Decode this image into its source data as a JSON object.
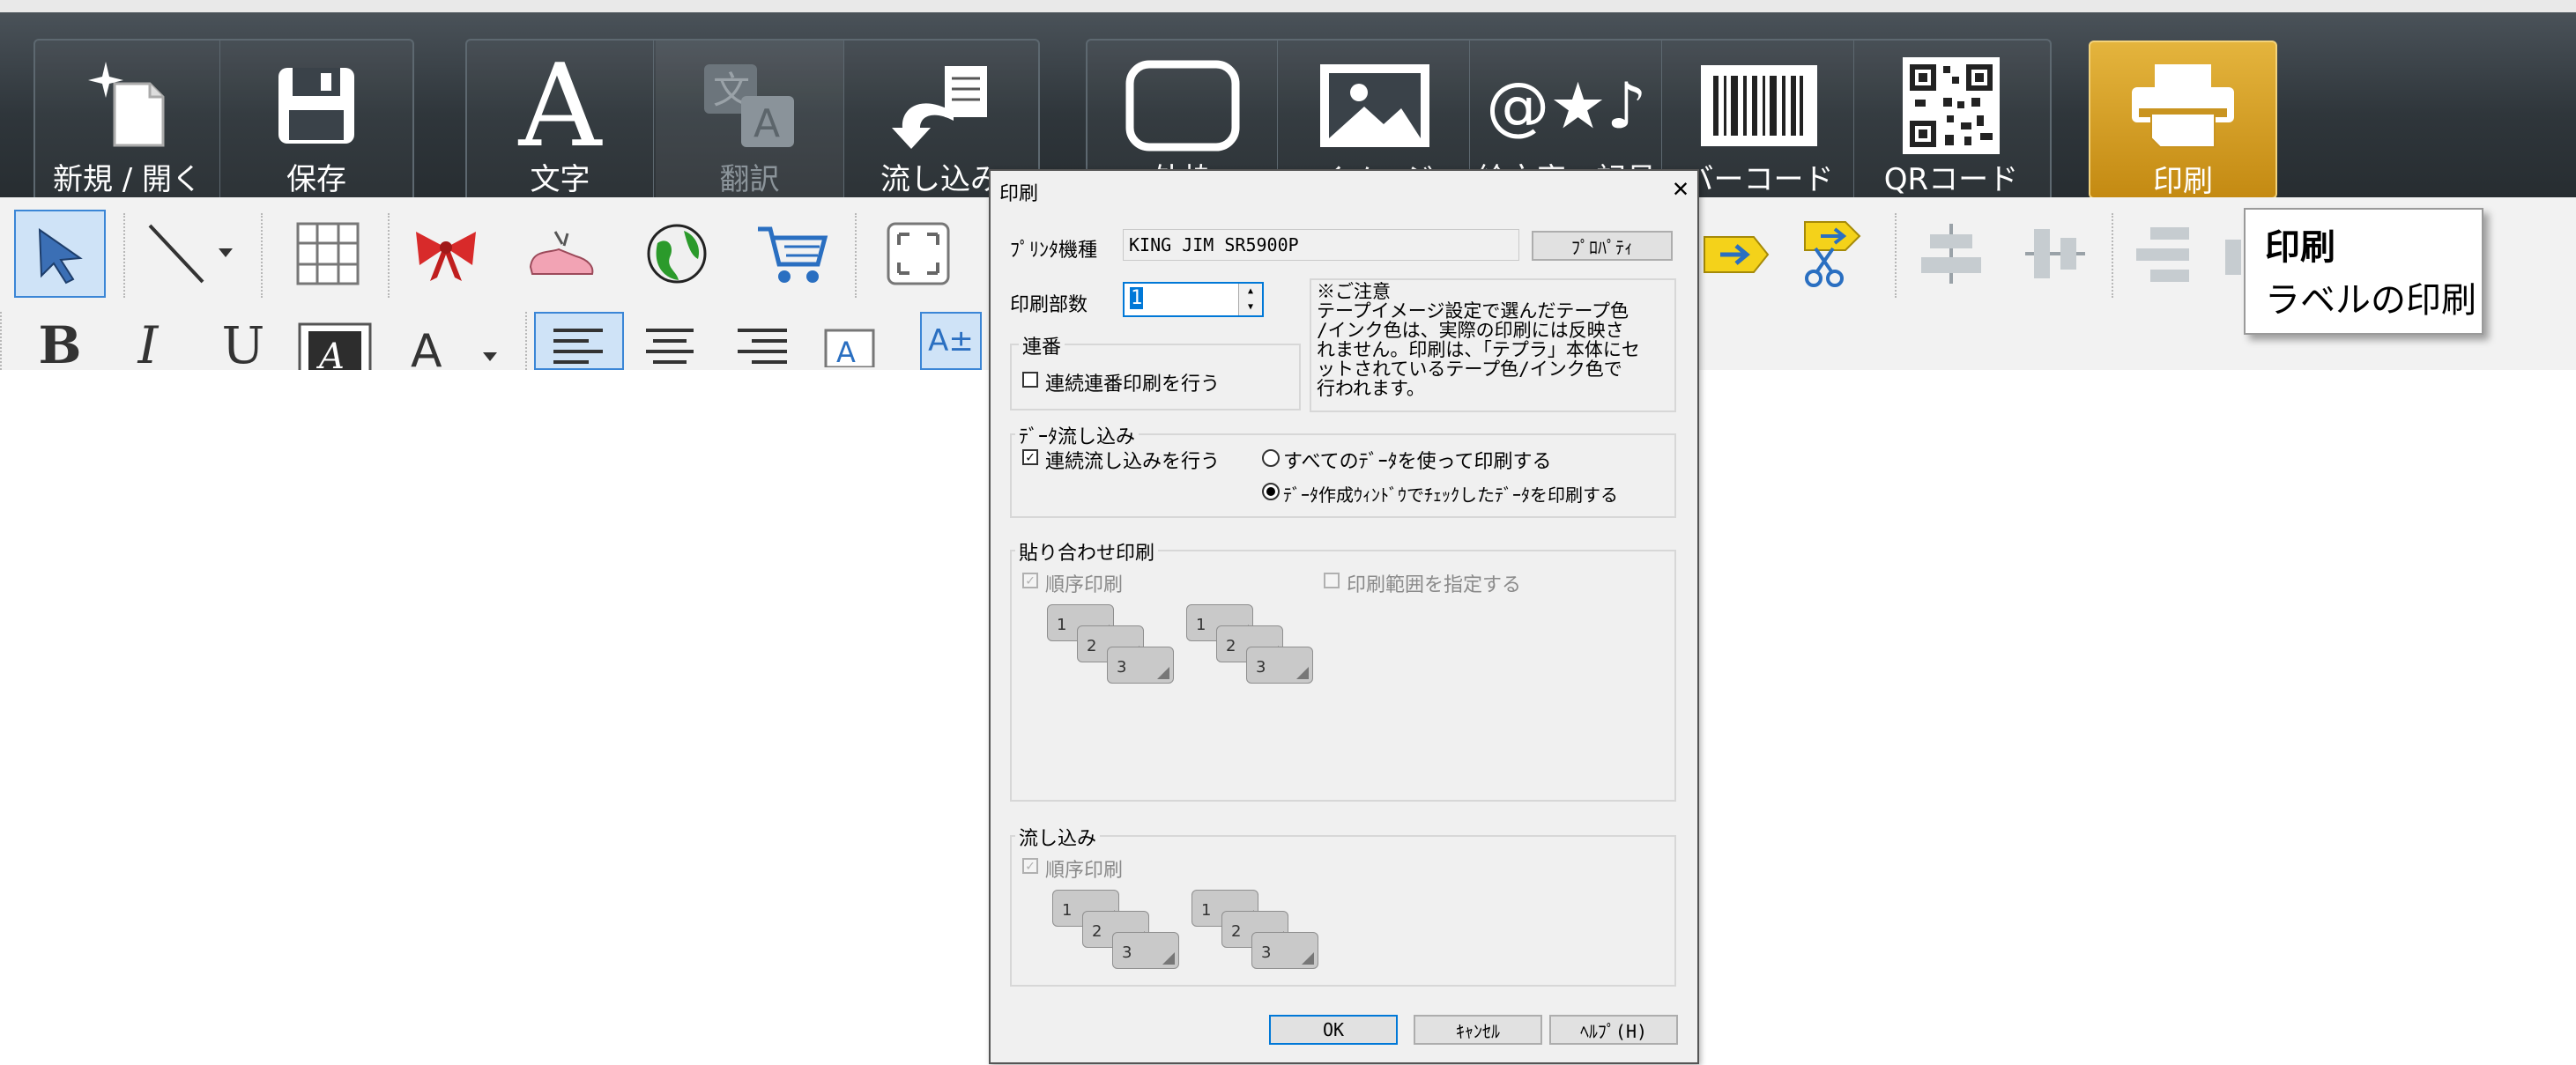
{
  "ribbon": {
    "buttons": [
      {
        "label": "新規 / 開く",
        "icon": "new-open-icon"
      },
      {
        "label": "保存",
        "icon": "save-icon"
      },
      {
        "label": "文字",
        "icon": "text-icon"
      },
      {
        "label": "翻訳",
        "icon": "translate-icon",
        "disabled": true
      },
      {
        "label": "流し込み",
        "icon": "data-flow-icon"
      },
      {
        "label": "外枠",
        "icon": "frame-icon"
      },
      {
        "label": "イメージ",
        "icon": "image-icon"
      },
      {
        "label": "絵文字・記号",
        "icon": "emoji-symbol-icon"
      },
      {
        "label": "バーコード",
        "icon": "barcode-icon"
      },
      {
        "label": "QRコード",
        "icon": "qrcode-icon"
      },
      {
        "label": "印刷",
        "icon": "printer-icon",
        "active": true
      }
    ]
  },
  "tooltip": {
    "title": "印刷",
    "description": "ラベルの印刷"
  },
  "dialog": {
    "title": "印刷",
    "printer_label": "ﾌﾟﾘﾝﾀ機種",
    "printer_value": "KING JIM SR5900P",
    "properties_button": "ﾌﾟﾛﾊﾟﾃｨ",
    "copies_label": "印刷部数",
    "copies_value": "1",
    "notice": [
      "※ご注意",
      "テープイメージ設定で選んだテープ色",
      "/インク色は、実際の印刷には反映さ",
      "れません。印刷は、「テプラ」本体にセ",
      "ットされているテープ色/インク色で",
      "行われます。"
    ],
    "serial_group": "連番",
    "serial_checkbox": "連続連番印刷を行う",
    "data_group": "ﾃﾞｰﾀ流し込み",
    "data_checkbox": "連続流し込みを行う",
    "data_radio_all": "すべてのﾃﾞｰﾀを使って印刷する",
    "data_radio_checked": "ﾃﾞｰﾀ作成ｳｨﾝﾄﾞｳでﾁｪｯｸしたﾃﾞｰﾀを印刷する",
    "paste_group": "貼り合わせ印刷",
    "paste_order": "順序印刷",
    "paste_range": "印刷範囲を指定する",
    "flow_group": "流し込み",
    "flow_order": "順序印刷",
    "sheet_numbers": [
      "1",
      "2",
      "3"
    ],
    "ok": "OK",
    "cancel": "ｷｬﾝｾﾙ",
    "help": "ﾍﾙﾌﾟ(H)"
  }
}
